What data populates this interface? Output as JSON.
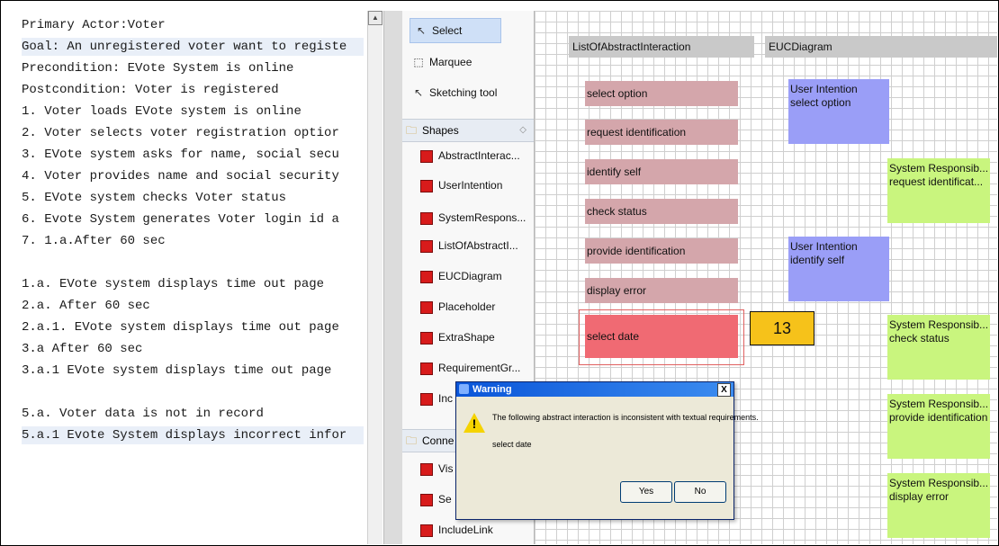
{
  "editor": {
    "lines": [
      {
        "text": "Primary Actor:Voter"
      },
      {
        "text": "Goal: An unregistered voter want to registe"
      },
      {
        "text": "Precondition: EVote System is online"
      },
      {
        "text": "Postcondition: Voter is registered"
      },
      {
        "text": "1.  Voter loads EVote system is online"
      },
      {
        "text": "2.  Voter selects voter registration optior"
      },
      {
        "text": "3.  EVote system asks for name, social secu"
      },
      {
        "text": "4.  Voter provides name and social security"
      },
      {
        "text": "5.  EVote system checks Voter status"
      },
      {
        "text": "6.  Evote System generates Voter login id a"
      },
      {
        "text": "7.  1.a.After 60 sec"
      },
      {
        "text": ""
      },
      {
        "text": "1.a. EVote system displays time out page"
      },
      {
        "text": "2.a. After 60 sec"
      },
      {
        "text": "2.a.1. EVote system displays time out page"
      },
      {
        "text": "3.a After 60 sec"
      },
      {
        "text": "3.a.1 EVote system displays time out page"
      },
      {
        "text": ""
      },
      {
        "text": "5.a. Voter data is not in record"
      },
      {
        "text": "5.a.1 Evote System displays incorrect infor"
      }
    ]
  },
  "palette": {
    "tools": [
      "Select",
      "Marquee",
      "Sketching tool"
    ],
    "shapes_drawer": "Shapes",
    "shapes": [
      "AbstractInterac...",
      "UserIntention",
      "SystemRespons...",
      "ListOfAbstractI...",
      "EUCDiagram",
      "Placeholder",
      "ExtraShape",
      "RequirementGr...",
      "Inc"
    ],
    "connections_drawer": "Conne",
    "connections": [
      "Vis",
      "Se",
      "IncludeLink"
    ]
  },
  "canvas": {
    "headers": [
      "ListOfAbstractInteraction",
      "EUCDiagram"
    ],
    "abstract_interactions": [
      "select option",
      "request identification",
      "identify self",
      "check status",
      "provide identification",
      "display error",
      "select date"
    ],
    "user_intentions": [
      {
        "line1": "User Intention",
        "line2": "select option"
      },
      {
        "line1": "User Intention",
        "line2": "identify self"
      }
    ],
    "system_responsibilities": [
      {
        "line1": "System Responsib...",
        "line2": "request identificat..."
      },
      {
        "line1": "System Responsib...",
        "line2": "check status"
      },
      {
        "line1": "System Responsib...",
        "line2": "provide identification"
      },
      {
        "line1": "System Responsib...",
        "line2": "display error"
      }
    ],
    "badge": "13"
  },
  "dialog": {
    "title": "Warning",
    "close": "X",
    "message": "The following abstract interaction is inconsistent with textual requirements.",
    "item": "select date",
    "yes": "Yes",
    "no": "No"
  },
  "colors": {
    "abstract_interaction": "#d4a6ab",
    "selected_interaction": "#f06a73",
    "user_intention": "#9a9ef7",
    "system_responsibility": "#c9f57e",
    "badge": "#f6c21a"
  }
}
